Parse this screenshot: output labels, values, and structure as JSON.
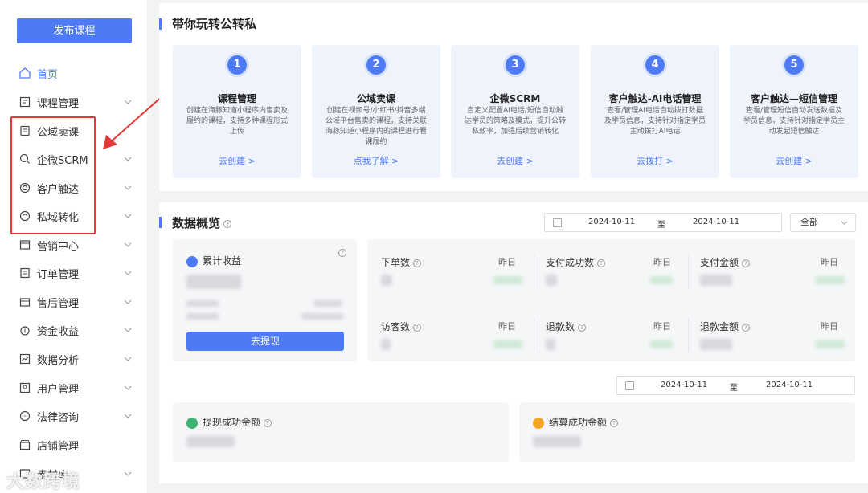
{
  "sidebar": {
    "publish_label": "发布课程",
    "items": [
      {
        "label": "首页",
        "icon": "home-icon"
      },
      {
        "label": "课程管理",
        "icon": "course-icon"
      },
      {
        "label": "公域卖课",
        "icon": "public-sale-icon"
      },
      {
        "label": "企微SCRM",
        "icon": "scrm-icon"
      },
      {
        "label": "客户触达",
        "icon": "reach-icon"
      },
      {
        "label": "私域转化",
        "icon": "convert-icon"
      },
      {
        "label": "营销中心",
        "icon": "marketing-icon"
      },
      {
        "label": "订单管理",
        "icon": "order-icon"
      },
      {
        "label": "售后管理",
        "icon": "aftersale-icon"
      },
      {
        "label": "资金收益",
        "icon": "money-icon"
      },
      {
        "label": "数据分析",
        "icon": "chart-icon"
      },
      {
        "label": "用户管理",
        "icon": "user-icon"
      },
      {
        "label": "法律咨询",
        "icon": "legal-icon"
      },
      {
        "label": "店铺管理",
        "icon": "shop-icon"
      },
      {
        "label": "素材库",
        "icon": "material-icon"
      }
    ]
  },
  "watermark": "大数跨境",
  "guide": {
    "title": "带你玩转公转私",
    "cards": [
      {
        "num": "1",
        "title": "课程管理",
        "desc": "创建在海豚知道小程序内售卖及履约的课程，支持多种课程形式上传",
        "link": "去创建 >"
      },
      {
        "num": "2",
        "title": "公域卖课",
        "desc": "创建在视频号/小红书/抖音多端公域平台售卖的课程，支持关联海豚知道小程序内的课程进行看课履约",
        "link": "点我了解 >"
      },
      {
        "num": "3",
        "title": "企微SCRM",
        "desc": "自定义配置AI电话/短信自动触达学员的策略及模式，提升公转私效率，加强后续营销转化",
        "link": "去创建 >"
      },
      {
        "num": "4",
        "title": "客户触达-AI电话管理",
        "desc": "查看/管理AI电话自动拨打数据及学员信息，支持针对指定学员主动拨打AI电话",
        "link": "去拨打 >"
      },
      {
        "num": "5",
        "title": "客户触达—短信管理",
        "desc": "查看/管理短信自动发送数据及学员信息，支持针对指定学员主动发起短信触达",
        "link": "去创建 >"
      }
    ]
  },
  "overview": {
    "title": "数据概览",
    "date_start": "2024-10-11",
    "date_sep": "至",
    "date_end": "2024-10-11",
    "select_value": "全部",
    "cumulative_label": "累计收益",
    "withdraw_label": "去提现",
    "stats_row1": [
      {
        "label": "下单数",
        "yest": "昨日"
      },
      {
        "label": "支付成功数",
        "yest": "昨日"
      },
      {
        "label": "支付金额",
        "yest": "昨日"
      }
    ],
    "stats_row2": [
      {
        "label": "访客数",
        "yest": "昨日"
      },
      {
        "label": "退款数",
        "yest": "昨日"
      },
      {
        "label": "退款金额",
        "yest": "昨日"
      }
    ],
    "date2_start": "2024-10-11",
    "date2_sep": "至",
    "date2_end": "2024-10-11",
    "withdraw_success_label": "提现成功金额",
    "settle_success_label": "结算成功金额"
  },
  "colors": {
    "accent": "#4e7af5",
    "highlight": "#e53935",
    "green": "#3cb371",
    "orange": "#f5a623"
  }
}
